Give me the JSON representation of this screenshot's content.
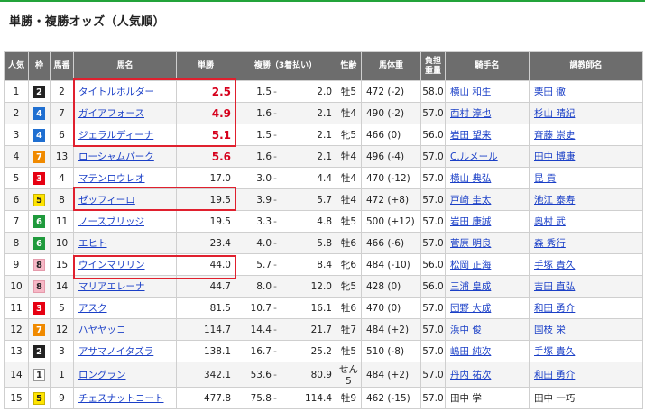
{
  "page": {
    "heading": "単勝・複勝オッズ（人気順）"
  },
  "table": {
    "headers": {
      "ninki": "人気",
      "waku": "枠",
      "umaban": "馬番",
      "bamei": "馬名",
      "tansho": "単勝",
      "fukusho": "複勝（3着払い）",
      "seirei": "性齢",
      "bataiju": "馬体重",
      "kinryo": "負担\n重量",
      "kishu": "騎手名",
      "chokyoshi": "調教師名"
    },
    "rows": [
      {
        "ninki": "1",
        "waku": "2",
        "umaban": "2",
        "bamei": "タイトルホルダー",
        "tansho": "2.5",
        "fuku_lo": "1.5",
        "fuku_hi": "2.0",
        "seirei": "牡5",
        "bataiju": "472 (-2)",
        "kinryo": "58.0",
        "kishu": "横山 和生",
        "chokyoshi": "栗田 徹",
        "hot": true,
        "link": true
      },
      {
        "ninki": "2",
        "waku": "4",
        "umaban": "7",
        "bamei": "ガイアフォース",
        "tansho": "4.9",
        "fuku_lo": "1.6",
        "fuku_hi": "2.1",
        "seirei": "牡4",
        "bataiju": "490 (-2)",
        "kinryo": "57.0",
        "kishu": "西村 淳也",
        "chokyoshi": "杉山 晴紀",
        "hot": true,
        "link": true
      },
      {
        "ninki": "3",
        "waku": "4",
        "umaban": "6",
        "bamei": "ジェラルディーナ",
        "tansho": "5.1",
        "fuku_lo": "1.5",
        "fuku_hi": "2.1",
        "seirei": "牝5",
        "bataiju": "466 (0)",
        "kinryo": "56.0",
        "kishu": "岩田 望来",
        "chokyoshi": "斉藤 崇史",
        "hot": true,
        "link": true
      },
      {
        "ninki": "4",
        "waku": "7",
        "umaban": "13",
        "bamei": "ローシャムパーク",
        "tansho": "5.6",
        "fuku_lo": "1.6",
        "fuku_hi": "2.1",
        "seirei": "牡4",
        "bataiju": "496 (-4)",
        "kinryo": "57.0",
        "kishu": "C.ルメール",
        "chokyoshi": "田中 博康",
        "hot": true,
        "link": true
      },
      {
        "ninki": "5",
        "waku": "3",
        "umaban": "4",
        "bamei": "マテンロウレオ",
        "tansho": "17.0",
        "fuku_lo": "3.0",
        "fuku_hi": "4.4",
        "seirei": "牡4",
        "bataiju": "470 (-12)",
        "kinryo": "57.0",
        "kishu": "横山 典弘",
        "chokyoshi": "昆 貢",
        "hot": false,
        "link": true
      },
      {
        "ninki": "6",
        "waku": "5",
        "umaban": "8",
        "bamei": "ゼッフィーロ",
        "tansho": "19.5",
        "fuku_lo": "3.9",
        "fuku_hi": "5.7",
        "seirei": "牡4",
        "bataiju": "472 (+8)",
        "kinryo": "57.0",
        "kishu": "戸崎 圭太",
        "chokyoshi": "池江 泰寿",
        "hot": false,
        "link": true
      },
      {
        "ninki": "7",
        "waku": "6",
        "umaban": "11",
        "bamei": "ノースブリッジ",
        "tansho": "19.5",
        "fuku_lo": "3.3",
        "fuku_hi": "4.8",
        "seirei": "牡5",
        "bataiju": "500 (+12)",
        "kinryo": "57.0",
        "kishu": "岩田 康誠",
        "chokyoshi": "奥村 武",
        "hot": false,
        "link": true
      },
      {
        "ninki": "8",
        "waku": "6",
        "umaban": "10",
        "bamei": "エヒト",
        "tansho": "23.4",
        "fuku_lo": "4.0",
        "fuku_hi": "5.8",
        "seirei": "牡6",
        "bataiju": "466 (-6)",
        "kinryo": "57.0",
        "kishu": "菅原 明良",
        "chokyoshi": "森 秀行",
        "hot": false,
        "link": true
      },
      {
        "ninki": "9",
        "waku": "8",
        "umaban": "15",
        "bamei": "ウインマリリン",
        "tansho": "44.0",
        "fuku_lo": "5.7",
        "fuku_hi": "8.4",
        "seirei": "牝6",
        "bataiju": "484 (-10)",
        "kinryo": "56.0",
        "kishu": "松岡 正海",
        "chokyoshi": "手塚 貴久",
        "hot": false,
        "link": true
      },
      {
        "ninki": "10",
        "waku": "8",
        "umaban": "14",
        "bamei": "マリアエレーナ",
        "tansho": "44.7",
        "fuku_lo": "8.0",
        "fuku_hi": "12.0",
        "seirei": "牝5",
        "bataiju": "428 (0)",
        "kinryo": "56.0",
        "kishu": "三浦 皇成",
        "chokyoshi": "吉田 直弘",
        "hot": false,
        "link": true
      },
      {
        "ninki": "11",
        "waku": "3",
        "umaban": "5",
        "bamei": "アスク",
        "tansho": "81.5",
        "fuku_lo": "10.7",
        "fuku_hi": "16.1",
        "seirei": "牡6",
        "bataiju": "470 (0)",
        "kinryo": "57.0",
        "kishu": "団野 大成",
        "chokyoshi": "和田 勇介",
        "hot": false,
        "link": true
      },
      {
        "ninki": "12",
        "waku": "7",
        "umaban": "12",
        "bamei": "ハヤヤッコ",
        "tansho": "114.7",
        "fuku_lo": "14.4",
        "fuku_hi": "21.7",
        "seirei": "牡7",
        "bataiju": "484 (+2)",
        "kinryo": "57.0",
        "kishu": "浜中 俊",
        "chokyoshi": "国枝 栄",
        "hot": false,
        "link": true
      },
      {
        "ninki": "13",
        "waku": "2",
        "umaban": "3",
        "bamei": "アサマノイタズラ",
        "tansho": "138.1",
        "fuku_lo": "16.7",
        "fuku_hi": "25.2",
        "seirei": "牡5",
        "bataiju": "510 (-8)",
        "kinryo": "57.0",
        "kishu": "嶋田 純次",
        "chokyoshi": "手塚 貴久",
        "hot": false,
        "link": true
      },
      {
        "ninki": "14",
        "waku": "1",
        "umaban": "1",
        "bamei": "ロングラン",
        "tansho": "342.1",
        "fuku_lo": "53.6",
        "fuku_hi": "80.9",
        "seirei": "せん5",
        "bataiju": "484 (+2)",
        "kinryo": "57.0",
        "kishu": "丹内 祐次",
        "chokyoshi": "和田 勇介",
        "hot": false,
        "link": true
      },
      {
        "ninki": "15",
        "waku": "5",
        "umaban": "9",
        "bamei": "チェスナットコート",
        "tansho": "477.8",
        "fuku_lo": "75.8",
        "fuku_hi": "114.4",
        "seirei": "牡9",
        "bataiju": "462 (-15)",
        "kinryo": "57.0",
        "kishu": "田中 学",
        "chokyoshi": "田中 一巧",
        "hot": false,
        "link": true
      }
    ],
    "fuku_dash": "-"
  },
  "colors": {
    "accent_green": "#23a33a",
    "highlight_red": "#e0202e",
    "odds_red": "#d6001c",
    "link_blue": "#1a3fc7"
  }
}
